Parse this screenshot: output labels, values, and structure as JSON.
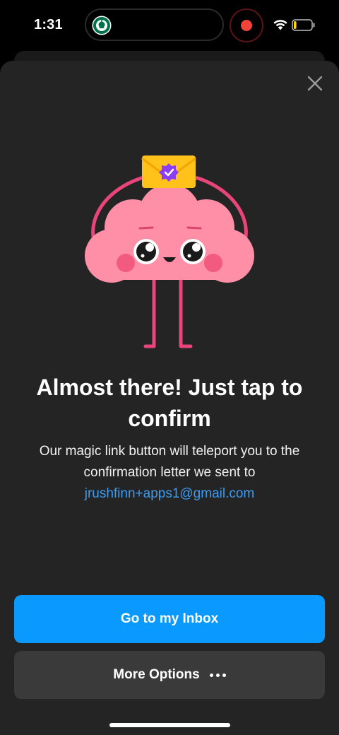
{
  "status_bar": {
    "time": "1:31",
    "app_icon": "starbucks-logo-icon",
    "recording_color": "#f0433a",
    "wifi_icon": "wifi-icon",
    "battery_icon": "battery-low-icon",
    "battery_level": 0.15
  },
  "sheet": {
    "close_icon": "close-icon",
    "illustration": "cloud-mascot-with-envelope",
    "headline": "Almost there! Just tap to confirm",
    "subtitle": "Our magic link button will teleport you to the confirmation letter we sent to",
    "email": "jrushfinn+apps1@gmail.com",
    "primary_button": "Go to my Inbox",
    "secondary_button": "More Options",
    "secondary_icon": "more-dots-icon"
  },
  "colors": {
    "accent": "#0a99ff",
    "link": "#3d9bf0",
    "sheet_bg": "#242424",
    "secondary_bg": "#3a3a3a",
    "mascot_pink": "#ff8fa6",
    "envelope_yellow": "#ffc21a"
  }
}
